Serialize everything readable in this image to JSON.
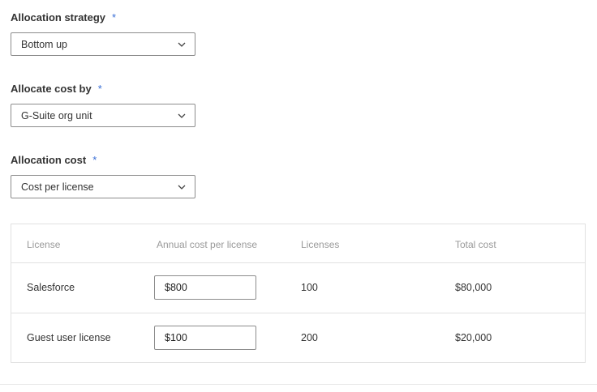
{
  "form": {
    "allocation_strategy": {
      "label": "Allocation strategy",
      "required_mark": "*",
      "value": "Bottom up"
    },
    "allocate_cost_by": {
      "label": "Allocate cost by",
      "required_mark": "*",
      "value": "G-Suite org unit"
    },
    "allocation_cost": {
      "label": "Allocation cost",
      "required_mark": "*",
      "value": "Cost per license"
    }
  },
  "table": {
    "headers": {
      "license": "License",
      "annual_cost": "Annual cost per license",
      "licenses": "Licenses",
      "total_cost": "Total cost"
    },
    "rows": [
      {
        "license": "Salesforce",
        "annual_cost": "$800",
        "licenses": "100",
        "total_cost": "$80,000"
      },
      {
        "license": "Guest user license",
        "annual_cost": "$100",
        "licenses": "200",
        "total_cost": "$20,000"
      }
    ]
  },
  "colors": {
    "required_asterisk": "#3b6fd6",
    "border": "#8c8c8c",
    "muted_text": "#999999"
  },
  "icons": {
    "select_chevron": "chevron-down-icon"
  }
}
